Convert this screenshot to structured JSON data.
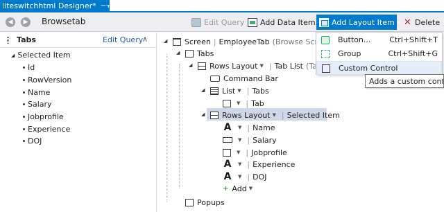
{
  "document_tab": {
    "title": "liteswitchhtml Designer*",
    "pin_icon": "pin-icon",
    "close_icon": "close-icon"
  },
  "toolbar": {
    "screen_name": "Browsetab",
    "edit_query": "Edit Query",
    "add_data_item": "Add Data Item...",
    "add_layout_item": "Add Layout Item",
    "delete": "Delete"
  },
  "left_panel": {
    "title": "Tabs",
    "edit_query": "Edit Query",
    "root": "Selected Item",
    "items": [
      "Id",
      "RowVersion",
      "Name",
      "Salary",
      "Jobprofile",
      "Experience",
      "DOJ"
    ]
  },
  "tree": {
    "screen_label": "Screen",
    "screen_name": "EmployeeTab",
    "screen_hint": "(Browse Screen)",
    "tabs": "Tabs",
    "rows_layout": "Rows Layout",
    "tab_list": "Tab List",
    "tab_list_hint": "(Tab)",
    "command_bar": "Command Bar",
    "list": "List",
    "list_source": "Tabs",
    "tab": "Tab",
    "rows_layout_2": "Rows Layout",
    "selected_item": "Selected Item",
    "fields": [
      "Name",
      "Salary",
      "Jobprofile",
      "Experience",
      "DOJ"
    ],
    "add": "Add",
    "popups": "Popups"
  },
  "menu": {
    "items": [
      {
        "label": "Button...",
        "shortcut": "Ctrl+Shift+T",
        "icon": "button-icon"
      },
      {
        "label": "Group",
        "shortcut": "Ctrl+Shift+G",
        "icon": "group-icon"
      },
      {
        "label": "Custom Control",
        "shortcut": "",
        "icon": "custom-control-icon"
      }
    ]
  },
  "tooltip": "Adds a custom control.",
  "colors": {
    "accent": "#007acc",
    "toolbar_bg": "#eeeef2",
    "selected_row": "#cfd8e8",
    "delete_red": "#c4282e",
    "link_blue": "#1e5fbf"
  }
}
